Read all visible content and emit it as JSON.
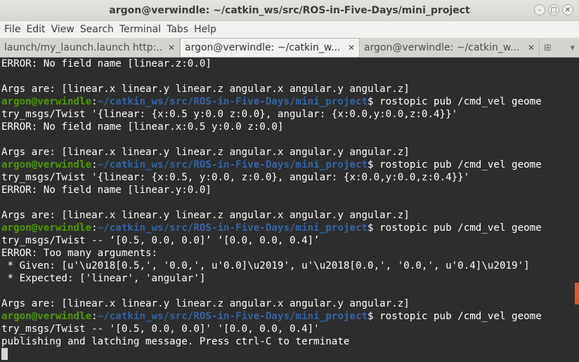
{
  "window": {
    "title": "argon@verwindle: ~/catkin_ws/src/ROS-in-Five-Days/mini_project",
    "controls": {
      "minimize": "–",
      "maximize": "□",
      "close": "✕"
    }
  },
  "menubar": [
    "File",
    "Edit",
    "View",
    "Search",
    "Terminal",
    "Tabs",
    "Help"
  ],
  "tabs": [
    {
      "label": "launch/my_launch.launch http:...",
      "close": "✕",
      "active": false
    },
    {
      "label": "argon@verwindle: ~/catkin_w...",
      "close": "✕",
      "active": true
    },
    {
      "label": "argon@verwindle: ~/catkin_w...",
      "close": "✕",
      "active": false
    }
  ],
  "new_tab": {
    "icon": "new-tab-icon",
    "glyph": "⊞",
    "dropdown": "▾"
  },
  "prompt": {
    "user": "argon@verwindle",
    "sep": ":",
    "path": "~/catkin_ws/src/ROS-in-Five-Days/mini_project",
    "dollar": "$"
  },
  "terminal_lines": [
    {
      "text": "ERROR: No field name [linear.z:0.0]"
    },
    {
      "text": ""
    },
    {
      "text": "Args are: [linear.x linear.y linear.z angular.x angular.y angular.z]"
    },
    {
      "prompt": true,
      "text": " rostopic pub /cmd_vel geome"
    },
    {
      "text": "try_msgs/Twist '{linear: {x:0.5 y:0.0 z:0.0}, angular: {x:0.0,y:0.0,z:0.4}}'"
    },
    {
      "text": "ERROR: No field name [linear.x:0.5 y:0.0 z:0.0]"
    },
    {
      "text": ""
    },
    {
      "text": "Args are: [linear.x linear.y linear.z angular.x angular.y angular.z]"
    },
    {
      "prompt": true,
      "text": " rostopic pub /cmd_vel geome"
    },
    {
      "text": "try_msgs/Twist '{linear: {x:0.5, y:0.0, z:0.0}, angular: {x:0.0,y:0.0,z:0.4}}'"
    },
    {
      "text": "ERROR: No field name [linear.y:0.0]"
    },
    {
      "text": ""
    },
    {
      "text": "Args are: [linear.x linear.y linear.z angular.x angular.y angular.z]"
    },
    {
      "prompt": true,
      "text": " rostopic pub /cmd_vel geome"
    },
    {
      "text": "try_msgs/Twist -- ‘[0.5, 0.0, 0.0]’ ‘[0.0, 0.0, 0.4]’"
    },
    {
      "text": "ERROR: Too many arguments:"
    },
    {
      "text": " * Given: [u'\\u2018[0.5,', '0.0,', u'0.0]\\u2019', u'\\u2018[0.0,', '0.0,', u'0.4]\\u2019']"
    },
    {
      "text": " * Expected: ['linear', 'angular']"
    },
    {
      "text": ""
    },
    {
      "text": "Args are: [linear.x linear.y linear.z angular.x angular.y angular.z]"
    },
    {
      "prompt": true,
      "text": " rostopic pub /cmd_vel geome"
    },
    {
      "text": "try_msgs/Twist -- '[0.5, 0.0, 0.0]' '[0.0, 0.0, 0.4]'"
    },
    {
      "text": "publishing and latching message. Press ctrl-C to terminate"
    },
    {
      "cursor": true,
      "text": ""
    }
  ],
  "colors": {
    "terminal_bg": "#2d2d2d",
    "prompt_user": "#4e9a06",
    "prompt_path": "#3465a4",
    "accent": "#e95420"
  }
}
